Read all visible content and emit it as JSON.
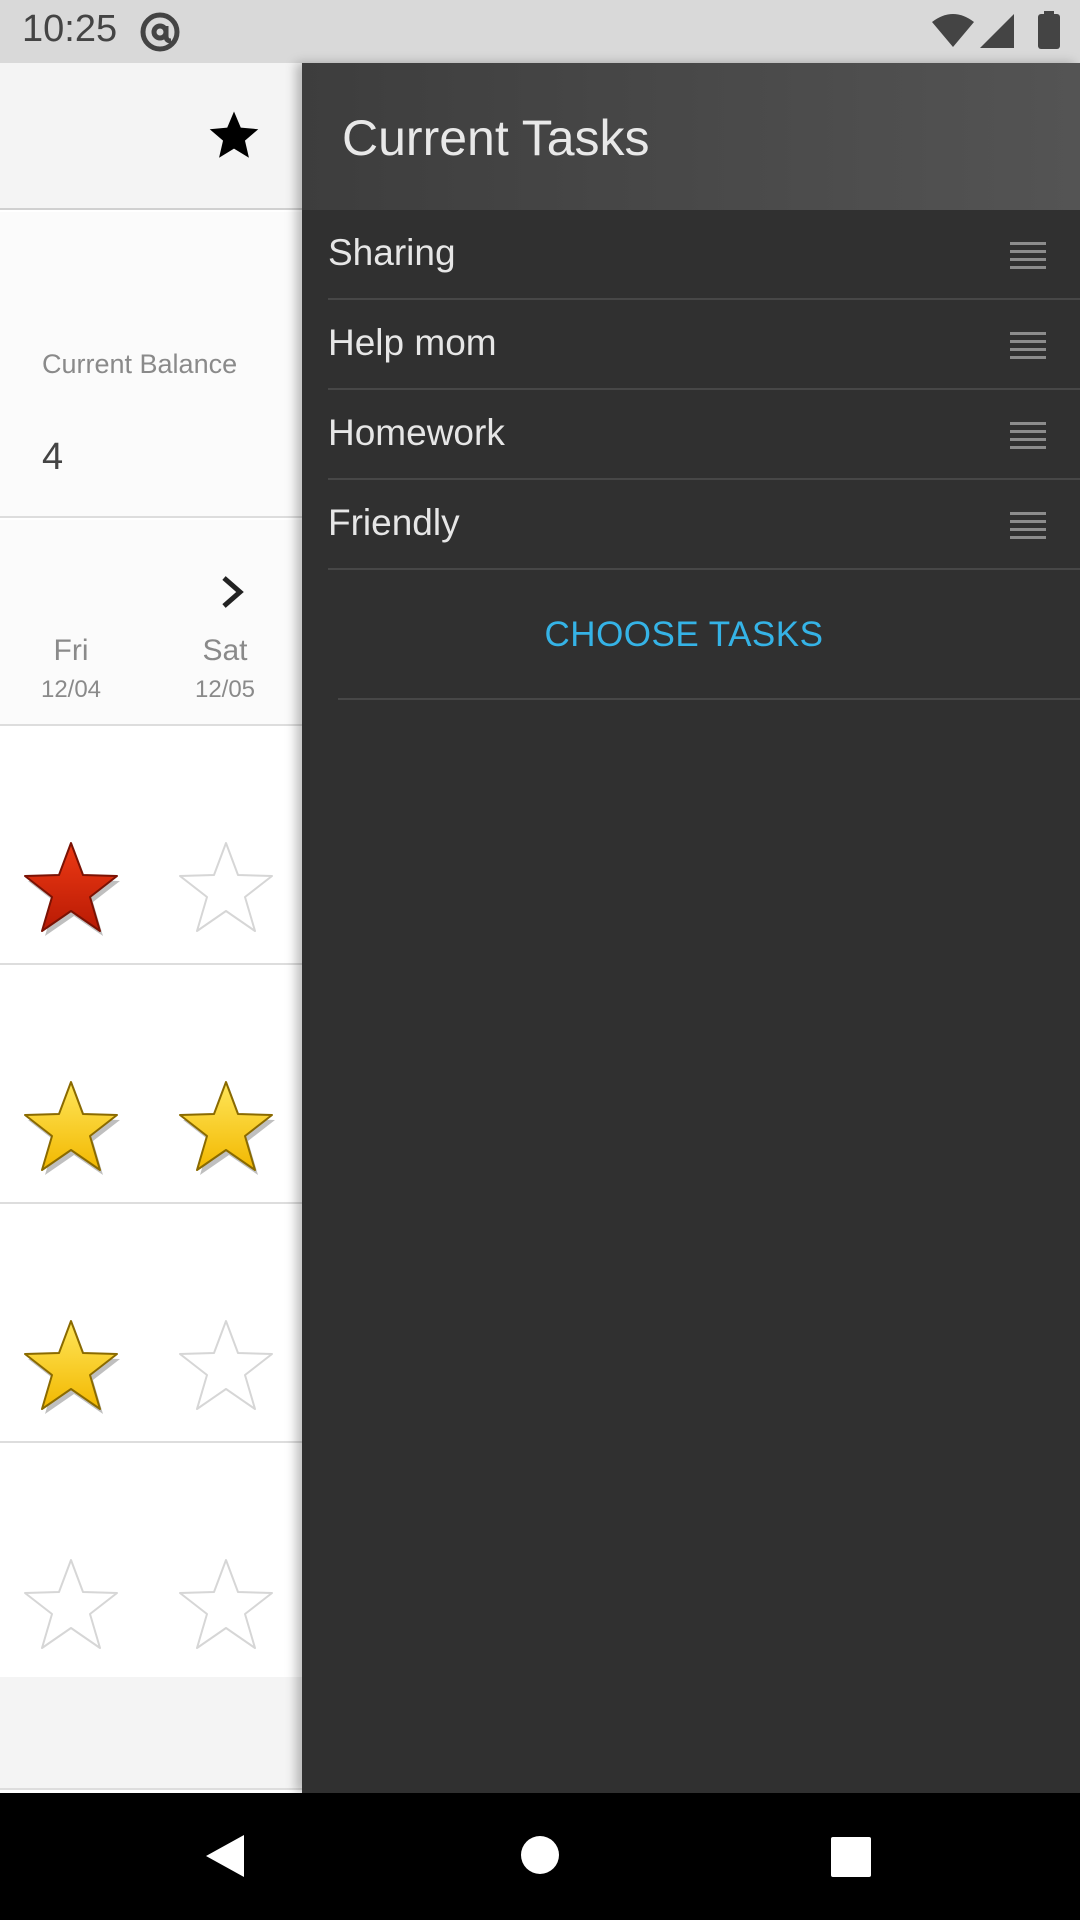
{
  "status_bar": {
    "time": "10:25",
    "icons": [
      "at-sign-icon",
      "wifi-icon",
      "cell-signal-icon",
      "battery-icon"
    ]
  },
  "left_panel": {
    "header_icon": "star-icon",
    "balance": {
      "label": "Current Balance",
      "value": "4"
    },
    "days": [
      {
        "name": "Fri",
        "date": "12/04"
      },
      {
        "name": "Sat",
        "date": "12/05"
      }
    ],
    "star_grid": [
      [
        "red",
        "empty"
      ],
      [
        "gold",
        "gold"
      ],
      [
        "gold",
        "empty"
      ],
      [
        "empty",
        "empty"
      ]
    ]
  },
  "drawer": {
    "title": "Current Tasks",
    "tasks": [
      {
        "label": "Sharing"
      },
      {
        "label": "Help mom"
      },
      {
        "label": "Homework"
      },
      {
        "label": "Friendly"
      }
    ],
    "choose_button": "CHOOSE TASKS"
  },
  "nav_bar": {
    "icons": [
      "back-icon",
      "home-icon",
      "recents-icon"
    ]
  },
  "colors": {
    "drawer_bg": "#303030",
    "accent": "#35b3e6",
    "star_gold": "#ffd21f",
    "star_red": "#d42a10"
  }
}
